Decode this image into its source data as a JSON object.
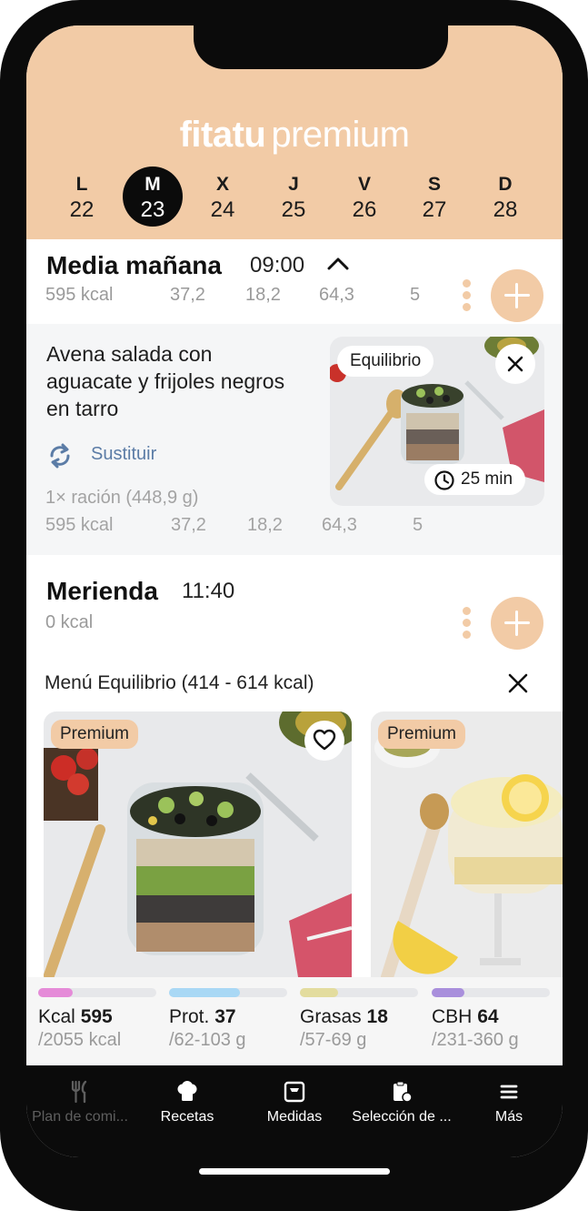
{
  "header": {
    "brand_bold": "fitatu",
    "brand_light": "premium",
    "days": [
      {
        "letter": "L",
        "number": "22"
      },
      {
        "letter": "M",
        "number": "23"
      },
      {
        "letter": "X",
        "number": "24"
      },
      {
        "letter": "J",
        "number": "25"
      },
      {
        "letter": "V",
        "number": "26"
      },
      {
        "letter": "S",
        "number": "27"
      },
      {
        "letter": "D",
        "number": "28"
      }
    ],
    "selected_day": "M"
  },
  "meal1": {
    "title": "Media mañana",
    "time": "09:00",
    "kcal": "595 kcal",
    "macros": [
      "37,2",
      "18,2",
      "64,3",
      "5"
    ],
    "recipe": {
      "name": "Avena salada con aguacate y frijoles negros en tarro",
      "swap_label": "Sustituir",
      "portion": "1× ración (448,9 g)",
      "kcal": "595 kcal",
      "macros": [
        "37,2",
        "18,2",
        "64,3",
        "5"
      ],
      "badge": "Equilibrio",
      "time": "25 min"
    }
  },
  "meal2": {
    "title": "Merienda",
    "time": "11:40",
    "kcal": "0 kcal",
    "menu_label": "Menú Equilibrio (414 - 614 kcal)",
    "suggestions": [
      {
        "tag": "Premium"
      },
      {
        "tag": "Premium"
      }
    ]
  },
  "stats": [
    {
      "name": "Kcal",
      "value": "595",
      "goal": "/2055 kcal",
      "color": "#e58bd8",
      "fill": 0.29
    },
    {
      "name": "Prot.",
      "value": "37",
      "goal": "/62-103 g",
      "color": "#a9d8f5",
      "fill": 0.6
    },
    {
      "name": "Grasas",
      "value": "18",
      "goal": "/57-69 g",
      "color": "#e3dc9e",
      "fill": 0.32
    },
    {
      "name": "CBH",
      "value": "64",
      "goal": "/231-360 g",
      "color": "#a98fdc",
      "fill": 0.28
    }
  ],
  "nav": [
    {
      "label": "Plan de comi...",
      "icon": "fork-knife-icon",
      "active": false
    },
    {
      "label": "Recetas",
      "icon": "chef-hat-icon",
      "active": true
    },
    {
      "label": "Medidas",
      "icon": "scale-icon",
      "active": true
    },
    {
      "label": "Selección de ...",
      "icon": "clipboard-icon",
      "active": true
    },
    {
      "label": "Más",
      "icon": "menu-icon",
      "active": true
    }
  ]
}
